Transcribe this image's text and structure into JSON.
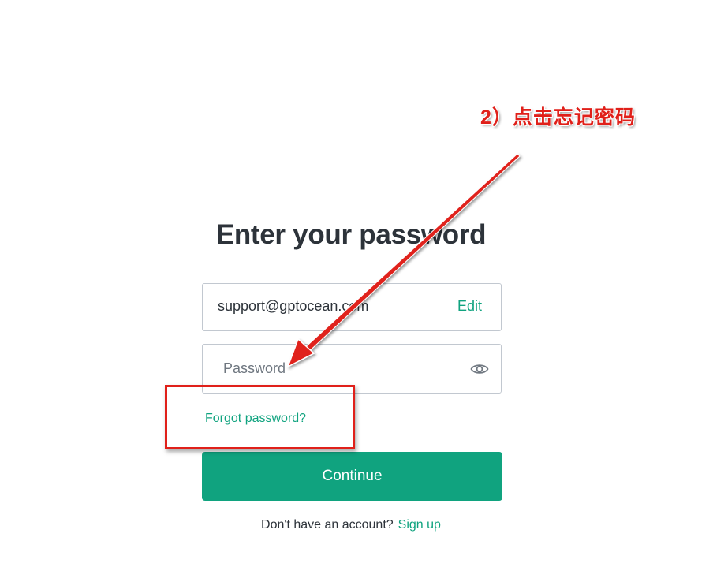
{
  "auth": {
    "title": "Enter your password",
    "email_value": "support@gptocean.com",
    "edit_label": "Edit",
    "password_placeholder": "Password",
    "forgot_password_label": "Forgot password?",
    "continue_label": "Continue",
    "no_account_text": "Don't have an account?",
    "signup_label": "Sign up"
  },
  "annotation": {
    "label": "2）点击忘记密码",
    "color": "#e0201a"
  },
  "colors": {
    "accent": "#10a37f",
    "text": "#2d333a",
    "border": "#c2c8d0"
  },
  "icons": {
    "password_toggle": "eye-icon"
  }
}
